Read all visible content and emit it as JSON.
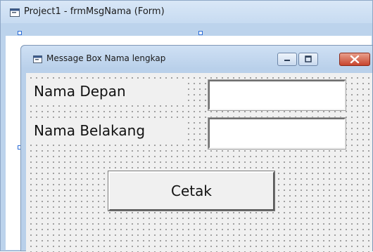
{
  "designer": {
    "title": "Project1 - frmMsgNama (Form)",
    "title_icon": "form-icon"
  },
  "form": {
    "title": "Message Box Nama lengkap",
    "title_icon": "form-icon",
    "controls": {
      "label_first_name": "Nama Depan",
      "label_last_name": "Nama Belakang",
      "input_first_name": "",
      "input_last_name": "",
      "print_button": "Cetak"
    },
    "window_buttons": [
      "minimize-icon",
      "maximize-icon",
      "close-icon"
    ]
  },
  "colors": {
    "titlebar": "#c7dbf1",
    "form_background": "#f0f0f0",
    "close_button": "#c8452e",
    "selection_handle": "#2b6cd6"
  }
}
